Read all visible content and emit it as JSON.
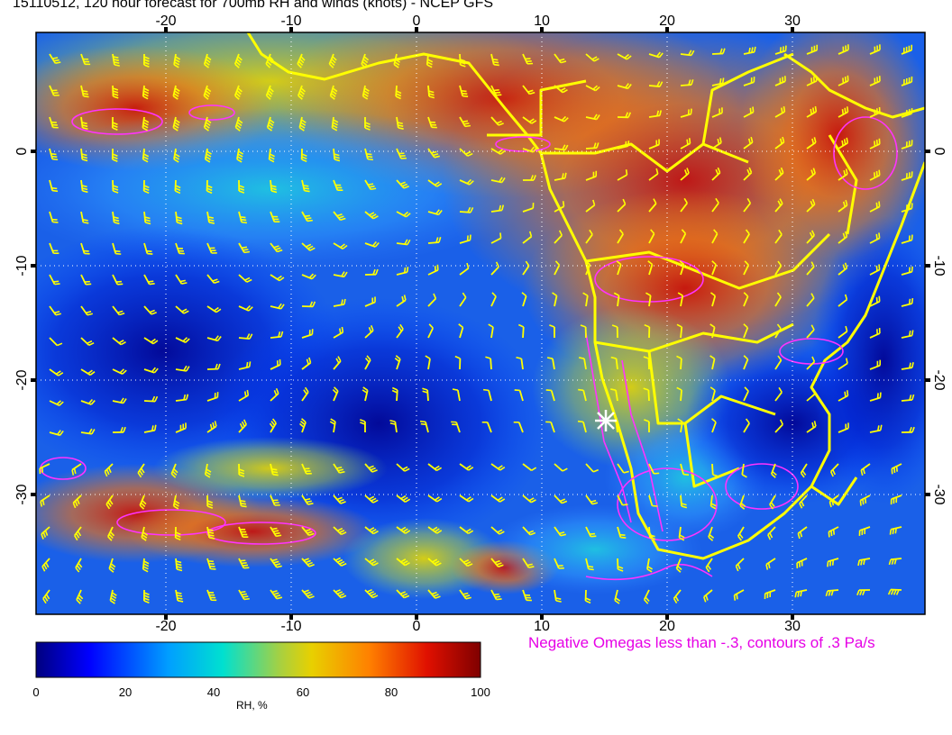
{
  "title": "15110512, 120 hour forecast for 700mb RH and winds (knots) - NCEP GFS",
  "map": {
    "lon_range": [
      -30,
      41
    ],
    "lat_range": [
      -41,
      10
    ],
    "lon_ticks": [
      "-20",
      "-10",
      "0",
      "10",
      "20",
      "30"
    ],
    "lat_ticks": [
      "0",
      "-10",
      "-20",
      "-30"
    ],
    "field": "700mb relative humidity",
    "overlays": [
      "wind barbs (knots)",
      "coastlines and borders",
      "negative omega contours"
    ],
    "marker": "white star near 15E 24S"
  },
  "omega_note": "Negative Omegas less than -.3, contours of .3 Pa/s",
  "colorbar": {
    "label": "RH, %",
    "ticks": [
      "0",
      "20",
      "40",
      "60",
      "80",
      "100"
    ],
    "colors": [
      "#00007f",
      "#0000ff",
      "#00a0ff",
      "#00e0d0",
      "#a8d040",
      "#e8d000",
      "#ff8000",
      "#e01000",
      "#7f0000"
    ]
  },
  "style": {
    "wind_color": "#ffff00",
    "coast_color": "#ffff00",
    "omega_color": "#ff33ff",
    "grid_color": "#ffffff"
  }
}
